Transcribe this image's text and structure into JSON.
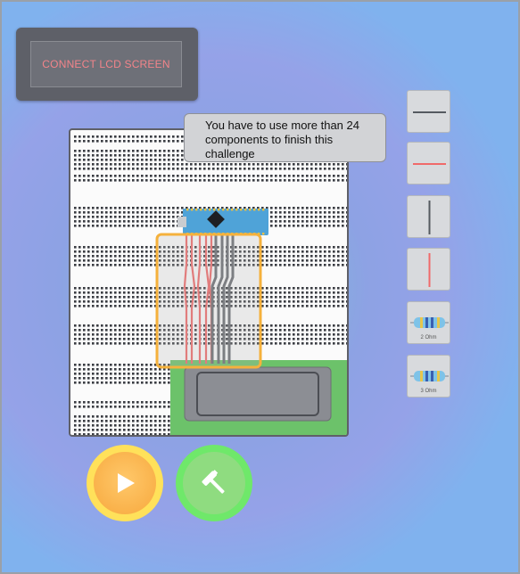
{
  "lcd": {
    "label": "CONNECT LCD SCREEN"
  },
  "tooltip": {
    "text": "You have to use more than 24 components to finish this challenge"
  },
  "palette": {
    "items": [
      {
        "kind": "wire-horizontal",
        "color": "#555a60"
      },
      {
        "kind": "wire-horizontal",
        "color": "#f06a6a"
      },
      {
        "kind": "wire-vertical",
        "color": "#555a60"
      },
      {
        "kind": "wire-vertical",
        "color": "#f06a6a"
      },
      {
        "kind": "resistor",
        "label": "2 Ohm"
      },
      {
        "kind": "resistor",
        "label": "3 Ohm"
      }
    ]
  },
  "controls": {
    "play_icon": "play-icon",
    "build_icon": "hammer-icon"
  },
  "colors": {
    "highlight": "#f5b13c",
    "lcd_text": "#f2848a",
    "wire_red": "#f06a6a",
    "wire_dark": "#6a6c72",
    "arduino": "#4fa3d8",
    "battery_green": "#6cc26a"
  }
}
